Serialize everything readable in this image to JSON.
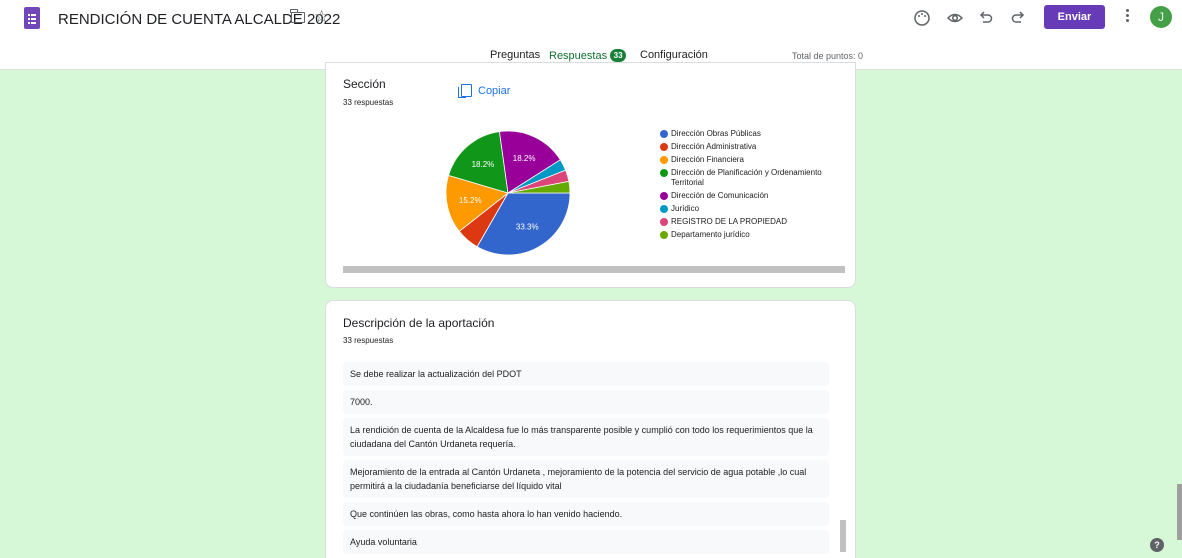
{
  "header": {
    "doc_title": "RENDICIÓN DE CUENTA ALCALDE 2022",
    "send_label": "Enviar",
    "avatar_letter": "J",
    "icons": [
      "forms-app-icon",
      "folder-icon",
      "star-icon",
      "palette-icon",
      "eye-icon",
      "undo-icon",
      "redo-icon",
      "more-vert-icon"
    ]
  },
  "tabs": {
    "questions": "Preguntas",
    "responses": "Respuestas",
    "responses_count": "33",
    "settings": "Configuración",
    "total_points": "Total de puntos: 0"
  },
  "section_card": {
    "title": "Sección",
    "subtitle": "33 respuestas",
    "copy_label": "Copiar"
  },
  "chart_data": {
    "type": "pie",
    "title": "Sección",
    "total_responses": 33,
    "series": [
      {
        "name": "Dirección Obras Públicas",
        "value": 33.3,
        "label": "33.3%",
        "color": "#3366cc"
      },
      {
        "name": "Dirección Administrativa",
        "value": 6.1,
        "label": "",
        "color": "#dc3912"
      },
      {
        "name": "Dirección Financiera",
        "value": 15.2,
        "label": "15.2%",
        "color": "#ff9900"
      },
      {
        "name": "Dirección de Planificación y Ordenamiento Territorial",
        "value": 18.2,
        "label": "18.2%",
        "color": "#109618"
      },
      {
        "name": "Dirección de Comunicación",
        "value": 18.2,
        "label": "18.2%",
        "color": "#990099"
      },
      {
        "name": "Jurídico",
        "value": 3.0,
        "label": "",
        "color": "#0099c6"
      },
      {
        "name": "REGISTRO DE LA PROPIEDAD",
        "value": 3.0,
        "label": "",
        "color": "#dd4477"
      },
      {
        "name": "Departamento jurídico",
        "value": 3.0,
        "label": "",
        "color": "#66aa00"
      }
    ],
    "legend": [
      "Dirección Obras Públicas",
      "Dirección Administrativa",
      "Dirección Financiera",
      "Dirección de Planificación y Ordenamiento Territorial",
      "Dirección de Comunicación",
      "Jurídico",
      "REGISTRO DE LA PROPIEDAD",
      "Departamento jurídico"
    ],
    "legend_position": "right"
  },
  "description_card": {
    "title": "Descripción de la aportación",
    "subtitle": "33 respuestas",
    "responses": [
      "Se debe realizar la actualización del PDOT",
      "7000.",
      "La rendición de cuenta de la Alcaldesa fue lo más transparente posible y cumplió con todo los requerimientos que la ciudadana del Cantón Urdaneta requería.",
      "Mejoramiento de la entrada al Cantón Urdaneta , mejoramiento de la potencia del servicio de agua potable ,lo cual permitirá a la ciudadanía beneficiarse del líquido vital",
      "Que continúen las obras, como hasta ahora lo han venido haciendo.",
      "Ayuda voluntaria"
    ]
  },
  "colors": {
    "accent": "#673ab7",
    "tab_active": "#137333",
    "background": "#d7f8d7",
    "link": "#1a73e8"
  }
}
